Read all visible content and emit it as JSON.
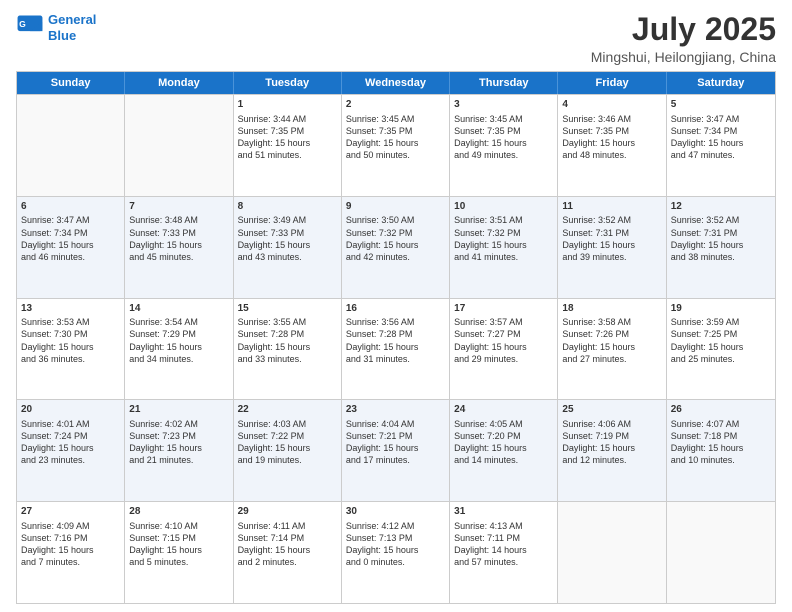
{
  "logo": {
    "line1": "General",
    "line2": "Blue"
  },
  "title": "July 2025",
  "subtitle": "Mingshui, Heilongjiang, China",
  "header_days": [
    "Sunday",
    "Monday",
    "Tuesday",
    "Wednesday",
    "Thursday",
    "Friday",
    "Saturday"
  ],
  "weeks": [
    [
      {
        "day": "",
        "info": ""
      },
      {
        "day": "",
        "info": ""
      },
      {
        "day": "1",
        "info": "Sunrise: 3:44 AM\nSunset: 7:35 PM\nDaylight: 15 hours\nand 51 minutes."
      },
      {
        "day": "2",
        "info": "Sunrise: 3:45 AM\nSunset: 7:35 PM\nDaylight: 15 hours\nand 50 minutes."
      },
      {
        "day": "3",
        "info": "Sunrise: 3:45 AM\nSunset: 7:35 PM\nDaylight: 15 hours\nand 49 minutes."
      },
      {
        "day": "4",
        "info": "Sunrise: 3:46 AM\nSunset: 7:35 PM\nDaylight: 15 hours\nand 48 minutes."
      },
      {
        "day": "5",
        "info": "Sunrise: 3:47 AM\nSunset: 7:34 PM\nDaylight: 15 hours\nand 47 minutes."
      }
    ],
    [
      {
        "day": "6",
        "info": "Sunrise: 3:47 AM\nSunset: 7:34 PM\nDaylight: 15 hours\nand 46 minutes."
      },
      {
        "day": "7",
        "info": "Sunrise: 3:48 AM\nSunset: 7:33 PM\nDaylight: 15 hours\nand 45 minutes."
      },
      {
        "day": "8",
        "info": "Sunrise: 3:49 AM\nSunset: 7:33 PM\nDaylight: 15 hours\nand 43 minutes."
      },
      {
        "day": "9",
        "info": "Sunrise: 3:50 AM\nSunset: 7:32 PM\nDaylight: 15 hours\nand 42 minutes."
      },
      {
        "day": "10",
        "info": "Sunrise: 3:51 AM\nSunset: 7:32 PM\nDaylight: 15 hours\nand 41 minutes."
      },
      {
        "day": "11",
        "info": "Sunrise: 3:52 AM\nSunset: 7:31 PM\nDaylight: 15 hours\nand 39 minutes."
      },
      {
        "day": "12",
        "info": "Sunrise: 3:52 AM\nSunset: 7:31 PM\nDaylight: 15 hours\nand 38 minutes."
      }
    ],
    [
      {
        "day": "13",
        "info": "Sunrise: 3:53 AM\nSunset: 7:30 PM\nDaylight: 15 hours\nand 36 minutes."
      },
      {
        "day": "14",
        "info": "Sunrise: 3:54 AM\nSunset: 7:29 PM\nDaylight: 15 hours\nand 34 minutes."
      },
      {
        "day": "15",
        "info": "Sunrise: 3:55 AM\nSunset: 7:28 PM\nDaylight: 15 hours\nand 33 minutes."
      },
      {
        "day": "16",
        "info": "Sunrise: 3:56 AM\nSunset: 7:28 PM\nDaylight: 15 hours\nand 31 minutes."
      },
      {
        "day": "17",
        "info": "Sunrise: 3:57 AM\nSunset: 7:27 PM\nDaylight: 15 hours\nand 29 minutes."
      },
      {
        "day": "18",
        "info": "Sunrise: 3:58 AM\nSunset: 7:26 PM\nDaylight: 15 hours\nand 27 minutes."
      },
      {
        "day": "19",
        "info": "Sunrise: 3:59 AM\nSunset: 7:25 PM\nDaylight: 15 hours\nand 25 minutes."
      }
    ],
    [
      {
        "day": "20",
        "info": "Sunrise: 4:01 AM\nSunset: 7:24 PM\nDaylight: 15 hours\nand 23 minutes."
      },
      {
        "day": "21",
        "info": "Sunrise: 4:02 AM\nSunset: 7:23 PM\nDaylight: 15 hours\nand 21 minutes."
      },
      {
        "day": "22",
        "info": "Sunrise: 4:03 AM\nSunset: 7:22 PM\nDaylight: 15 hours\nand 19 minutes."
      },
      {
        "day": "23",
        "info": "Sunrise: 4:04 AM\nSunset: 7:21 PM\nDaylight: 15 hours\nand 17 minutes."
      },
      {
        "day": "24",
        "info": "Sunrise: 4:05 AM\nSunset: 7:20 PM\nDaylight: 15 hours\nand 14 minutes."
      },
      {
        "day": "25",
        "info": "Sunrise: 4:06 AM\nSunset: 7:19 PM\nDaylight: 15 hours\nand 12 minutes."
      },
      {
        "day": "26",
        "info": "Sunrise: 4:07 AM\nSunset: 7:18 PM\nDaylight: 15 hours\nand 10 minutes."
      }
    ],
    [
      {
        "day": "27",
        "info": "Sunrise: 4:09 AM\nSunset: 7:16 PM\nDaylight: 15 hours\nand 7 minutes."
      },
      {
        "day": "28",
        "info": "Sunrise: 4:10 AM\nSunset: 7:15 PM\nDaylight: 15 hours\nand 5 minutes."
      },
      {
        "day": "29",
        "info": "Sunrise: 4:11 AM\nSunset: 7:14 PM\nDaylight: 15 hours\nand 2 minutes."
      },
      {
        "day": "30",
        "info": "Sunrise: 4:12 AM\nSunset: 7:13 PM\nDaylight: 15 hours\nand 0 minutes."
      },
      {
        "day": "31",
        "info": "Sunrise: 4:13 AM\nSunset: 7:11 PM\nDaylight: 14 hours\nand 57 minutes."
      },
      {
        "day": "",
        "info": ""
      },
      {
        "day": "",
        "info": ""
      }
    ]
  ]
}
